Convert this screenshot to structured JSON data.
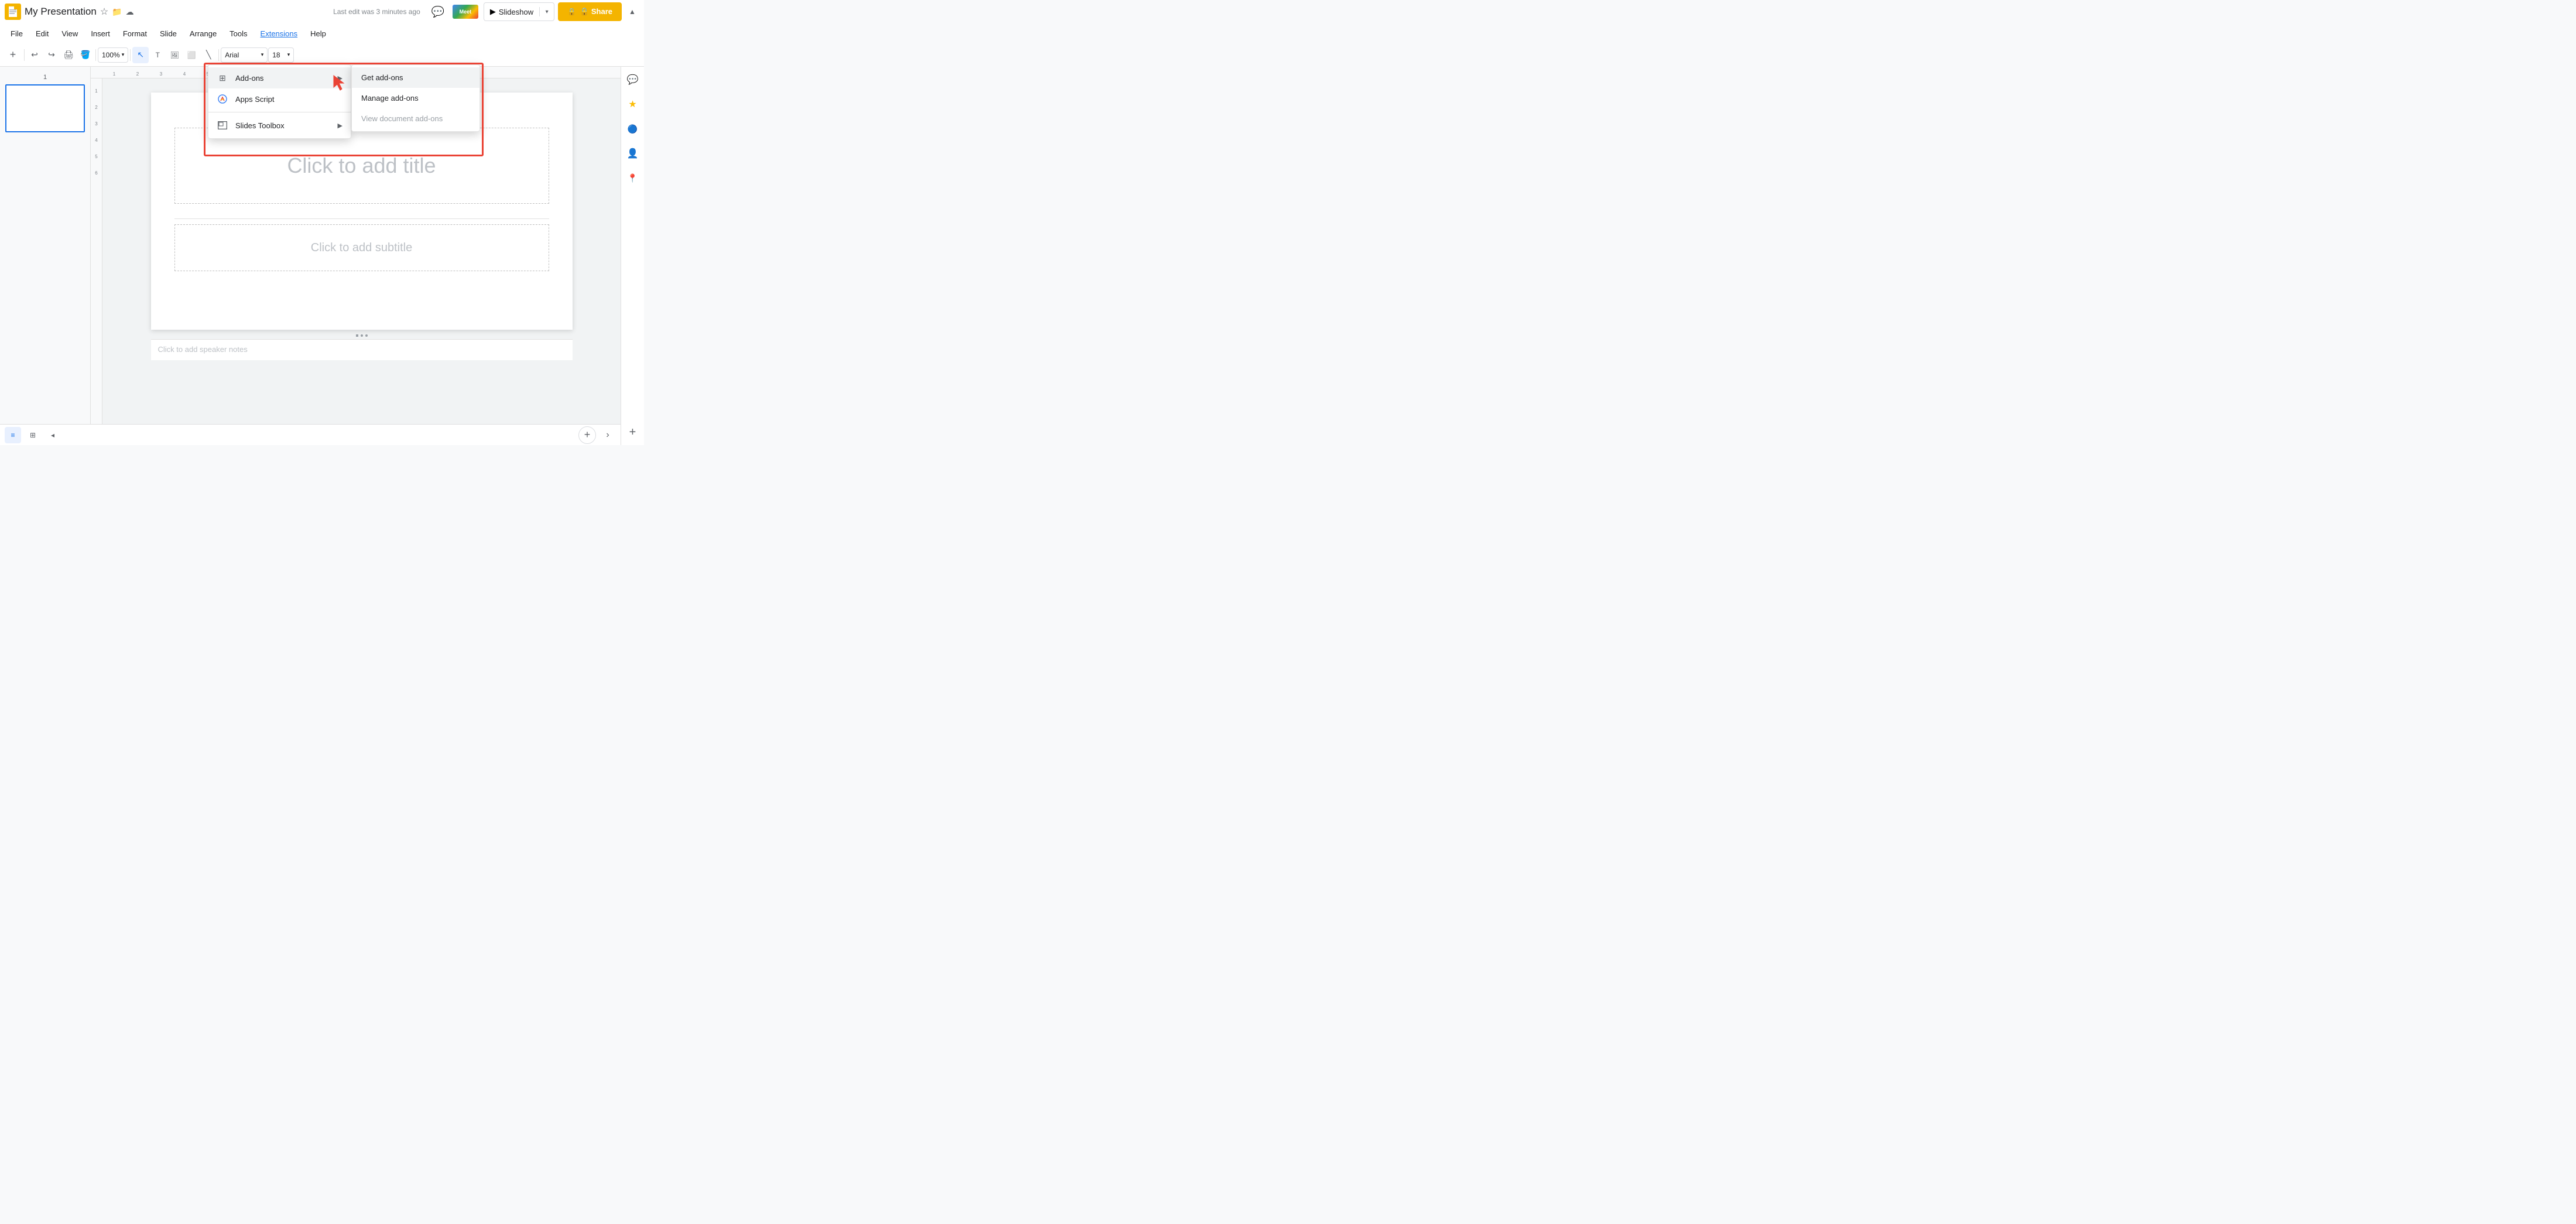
{
  "app": {
    "icon_label": "Google Slides",
    "title": "My Presentation",
    "last_edit": "Last edit was 3 minutes ago"
  },
  "title_bar": {
    "star_icon": "★",
    "folder_icon": "⊡",
    "cloud_icon": "☁"
  },
  "menu": {
    "items": [
      {
        "id": "file",
        "label": "File"
      },
      {
        "id": "edit",
        "label": "Edit"
      },
      {
        "id": "view",
        "label": "View"
      },
      {
        "id": "insert",
        "label": "Insert"
      },
      {
        "id": "format",
        "label": "Format"
      },
      {
        "id": "slide",
        "label": "Slide"
      },
      {
        "id": "arrange",
        "label": "Arrange"
      },
      {
        "id": "tools",
        "label": "Tools"
      },
      {
        "id": "extensions",
        "label": "Extensions",
        "active": true
      },
      {
        "id": "help",
        "label": "Help"
      }
    ]
  },
  "toolbar": {
    "zoom_value": "100%",
    "font_name": "Arial",
    "font_size": "18"
  },
  "header": {
    "comment_icon": "💬",
    "slideshow_label": "Slideshow",
    "share_label": "🔒 Share",
    "chevron_up": "^",
    "meet_label": "Meet"
  },
  "extensions_menu": {
    "items": [
      {
        "id": "addons",
        "label": "Add-ons",
        "has_arrow": true,
        "icon": "grid"
      },
      {
        "id": "apps_script",
        "label": "Apps Script",
        "icon": "script"
      },
      {
        "id": "slides_toolbox",
        "label": "Slides Toolbox",
        "has_arrow": true,
        "icon": "slides"
      }
    ]
  },
  "addons_submenu": {
    "items": [
      {
        "id": "get_addons",
        "label": "Get add-ons",
        "active": true
      },
      {
        "id": "manage_addons",
        "label": "Manage add-ons",
        "active": false
      },
      {
        "id": "view_doc_addons",
        "label": "View document add-ons",
        "disabled": true
      }
    ]
  },
  "slide": {
    "title_placeholder": "Click to add title",
    "subtitle_placeholder": "Click to add subtitle",
    "notes_placeholder": "Click to add speaker notes"
  },
  "right_sidebar": {
    "icons": [
      "chat",
      "explore",
      "keep",
      "account",
      "maps"
    ]
  },
  "bottom_bar": {
    "add_slide_icon": "+",
    "next_icon": "›"
  }
}
